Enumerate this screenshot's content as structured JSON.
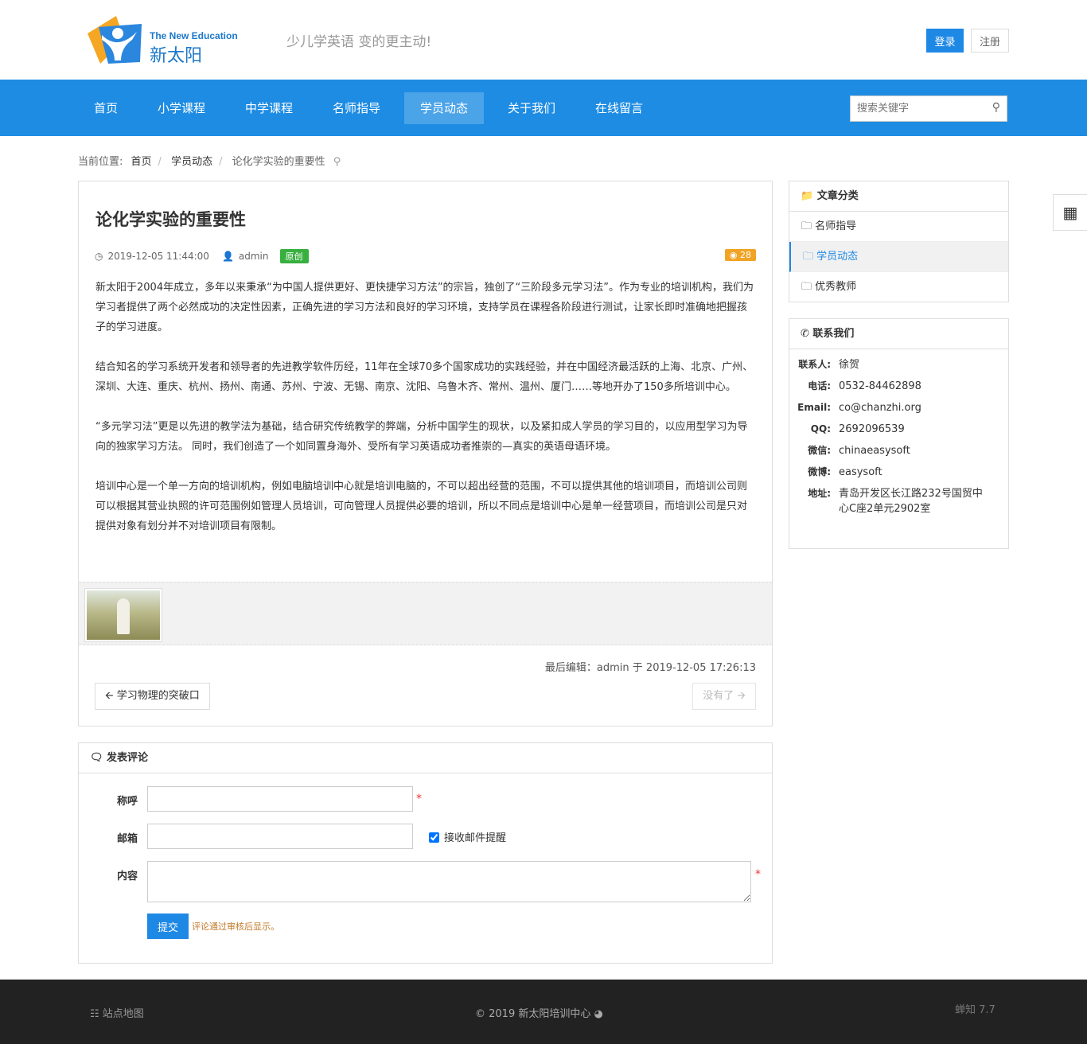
{
  "header": {
    "logo_en": "The New Education",
    "logo_cn": "新太阳",
    "slogan": "少儿学英语 变的更主动!",
    "login": "登录",
    "register": "注册"
  },
  "nav": {
    "items": [
      "首页",
      "小学课程",
      "中学课程",
      "名师指导",
      "学员动态",
      "关于我们",
      "在线留言"
    ],
    "active": 4,
    "search_placeholder": "搜索关键字"
  },
  "breadcrumb": {
    "label": "当前位置:",
    "items": [
      "首页",
      "学员动态",
      "论化学实验的重要性"
    ]
  },
  "article": {
    "title": "论化学实验的重要性",
    "date": "2019-12-05 11:44:00",
    "author": "admin",
    "badge": "原创",
    "views": "28",
    "paragraphs": [
      "新太阳于2004年成立，多年以来秉承“为中国人提供更好、更快捷学习方法”的宗旨，独创了“三阶段多元学习法”。作为专业的培训机构，我们为学习者提供了两个必然成功的决定性因素，正确先进的学习方法和良好的学习环境，支持学员在课程各阶段进行测试，让家长即时准确地把握孩子的学习进度。",
      "结合知名的学习系统开发者和领导者的先进教学软件历经，11年在全球70多个国家成功的实践经验，并在中国经济最活跃的上海、北京、广州、深圳、大连、重庆、杭州、扬州、南通、苏州、宁波、无锡、南京、沈阳、乌鲁木齐、常州、温州、厦门……等地开办了150多所培训中心。",
      "“多元学习法”更是以先进的教学法为基础，结合研究传统教学的弊端，分析中国学生的现状，以及紧扣成人学员的学习目的，以应用型学习为导向的独家学习方法。 同时，我们创造了一个如同置身海外、受所有学习英语成功者推崇的—真实的英语母语环境。",
      "培训中心是一个单一方向的培训机构，例如电脑培训中心就是培训电脑的，不可以超出经营的范围，不可以提供其他的培训项目，而培训公司则可以根据其营业执照的许可范围例如管理人员培训，可向管理人员提供必要的培训，所以不同点是培训中心是单一经营项目，而培训公司是只对提供对象有划分并不对培训项目有限制。"
    ],
    "last_edit": "最后编辑：admin 于 2019-12-05 17:26:13",
    "prev": "学习物理的突破口",
    "next": "没有了"
  },
  "comment": {
    "title": "发表评论",
    "name_label": "称呼",
    "email_label": "邮箱",
    "content_label": "内容",
    "notify_label": "接收邮件提醒",
    "submit": "提交",
    "hint": "评论通过审核后显示。"
  },
  "sidebar": {
    "category_title": "文章分类",
    "categories": [
      "名师指导",
      "学员动态",
      "优秀教师"
    ],
    "active": 1,
    "contact_title": "联系我们",
    "contact": [
      {
        "k": "联系人:",
        "v": "徐贺"
      },
      {
        "k": "电话:",
        "v": "0532-84462898"
      },
      {
        "k": "Email:",
        "v": "co@chanzhi.org"
      },
      {
        "k": "QQ:",
        "v": "2692096539"
      },
      {
        "k": "微信:",
        "v": "chinaeasysoft"
      },
      {
        "k": "微博:",
        "v": "easysoft"
      },
      {
        "k": "地址:",
        "v": "青岛开发区长江路232号国贸中心C座2单元2902室"
      }
    ]
  },
  "footer": {
    "sitemap": "站点地图",
    "copyright": "© 2019 新太阳培训中心",
    "powered": "蝉知 7.7"
  }
}
